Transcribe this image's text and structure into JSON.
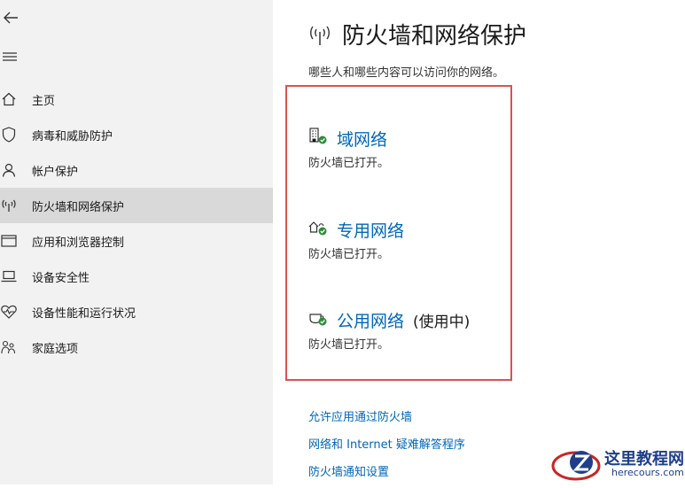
{
  "sidebar": {
    "items": [
      {
        "label": "主页",
        "icon": "home-icon"
      },
      {
        "label": "病毒和威胁防护",
        "icon": "shield-icon"
      },
      {
        "label": "帐户保护",
        "icon": "person-icon"
      },
      {
        "label": "防火墙和网络保护",
        "icon": "wifi-antenna-icon",
        "active": true
      },
      {
        "label": "应用和浏览器控制",
        "icon": "browser-window-icon"
      },
      {
        "label": "设备安全性",
        "icon": "laptop-icon"
      },
      {
        "label": "设备性能和运行状况",
        "icon": "heart-pulse-icon"
      },
      {
        "label": "家庭选项",
        "icon": "family-icon"
      }
    ]
  },
  "main": {
    "title": "防火墙和网络保护",
    "subtitle": "哪些人和哪些内容可以访问你的网络。",
    "networks": [
      {
        "name": "域网络",
        "suffix": "",
        "status": "防火墙已打开。",
        "icon": "domain-network-icon"
      },
      {
        "name": "专用网络",
        "suffix": "",
        "status": "防火墙已打开。",
        "icon": "private-network-icon"
      },
      {
        "name": "公用网络",
        "suffix": "(使用中)",
        "status": "防火墙已打开。",
        "icon": "public-network-icon"
      }
    ],
    "links": [
      "允许应用通过防火墙",
      "网络和 Internet 疑难解答程序",
      "防火墙通知设置"
    ]
  },
  "watermark": {
    "text": "这里教程网",
    "sub": "herecours.com"
  },
  "colors": {
    "link": "#0067b8",
    "highlight": "#d9534f",
    "check": "#2e8b3a"
  }
}
